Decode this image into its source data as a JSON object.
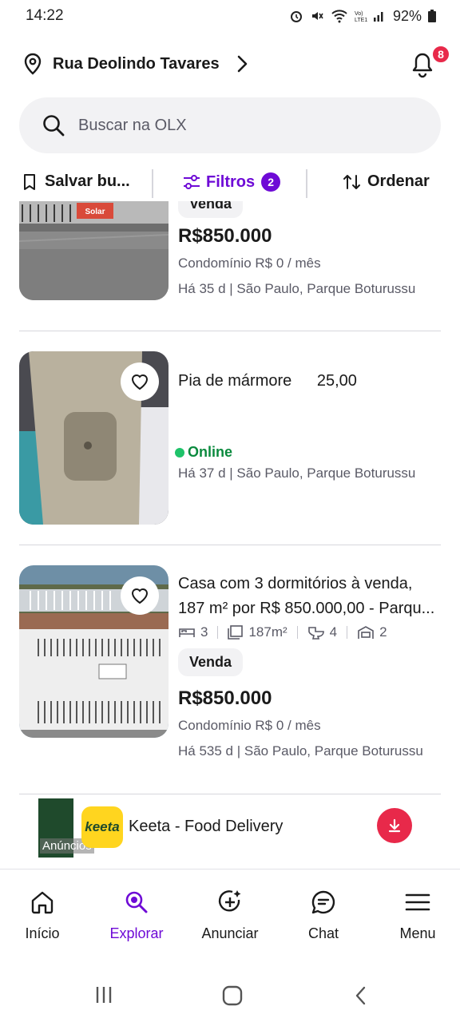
{
  "status_bar": {
    "time": "14:22",
    "battery": "92%"
  },
  "header": {
    "address": "Rua Deolindo Tavares",
    "notification_count": "8"
  },
  "search": {
    "placeholder": "Buscar na OLX"
  },
  "toolbar": {
    "save_label": "Salvar bu...",
    "filter_label": "Filtros",
    "filter_count": "2",
    "order_label": "Ordenar"
  },
  "listings": [
    {
      "tag": "Venda",
      "price": "R$850.000",
      "condo": "Condomínio R$ 0 / mês",
      "meta": "Há 35 d | São Paulo, Parque Boturussu",
      "thumb_text": "Solar"
    },
    {
      "title": "Pia de mármore",
      "price": "25,00",
      "status": "Online",
      "meta": "Há 37 d | São Paulo, Parque Boturussu"
    },
    {
      "title_line1": "Casa com 3 dormitórios à venda,",
      "title_line2": "187 m² por R$ 850.000,00 - Parqu...",
      "specs": {
        "beds": "3",
        "area": "187m²",
        "baths": "4",
        "parking": "2"
      },
      "tag": "Venda",
      "price": "R$850.000",
      "condo": "Condomínio R$ 0 / mês",
      "meta": "Há 535 d | São Paulo, Parque Boturussu"
    }
  ],
  "ad": {
    "label": "Anúncios",
    "logo_text": "keeta",
    "name": "Keeta - Food Delivery"
  },
  "bottom_nav": [
    {
      "label": "Início",
      "icon": "home-icon"
    },
    {
      "label": "Explorar",
      "icon": "explore-icon"
    },
    {
      "label": "Anunciar",
      "icon": "add-ad-icon"
    },
    {
      "label": "Chat",
      "icon": "chat-icon"
    },
    {
      "label": "Menu",
      "icon": "menu-icon"
    }
  ],
  "colors": {
    "accent": "#6e0ad6",
    "badge": "#e8294a",
    "online": "#0b8a3e"
  }
}
